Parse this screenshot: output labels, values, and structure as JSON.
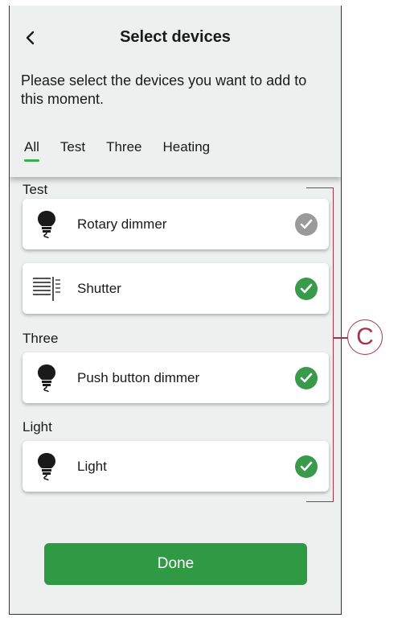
{
  "header": {
    "title": "Select devices",
    "instructions": "Please select the devices you want to add to this moment."
  },
  "tabs": [
    {
      "label": "All",
      "active": true
    },
    {
      "label": "Test",
      "active": false
    },
    {
      "label": "Three",
      "active": false
    },
    {
      "label": "Heating",
      "active": false
    }
  ],
  "sections": [
    {
      "label": "Test"
    },
    {
      "label": "Three"
    },
    {
      "label": "Light"
    }
  ],
  "devices": [
    {
      "name": "Rotary dimmer",
      "icon": "bulb-icon",
      "selected": true,
      "check_color": "#9a9a9a"
    },
    {
      "name": "Shutter",
      "icon": "shutter-icon",
      "selected": true,
      "check_color": "#3a9a4b"
    },
    {
      "name": "Push button dimmer",
      "icon": "bulb-icon",
      "selected": true,
      "check_color": "#3a9a4b"
    },
    {
      "name": "Light",
      "icon": "bulb-icon",
      "selected": true,
      "check_color": "#3a9a4b"
    }
  ],
  "done_label": "Done",
  "callout": "C",
  "colors": {
    "accent": "#3daa4f",
    "button": "#2f9944",
    "callout": "#a8324a",
    "background": "#eef0ef"
  }
}
